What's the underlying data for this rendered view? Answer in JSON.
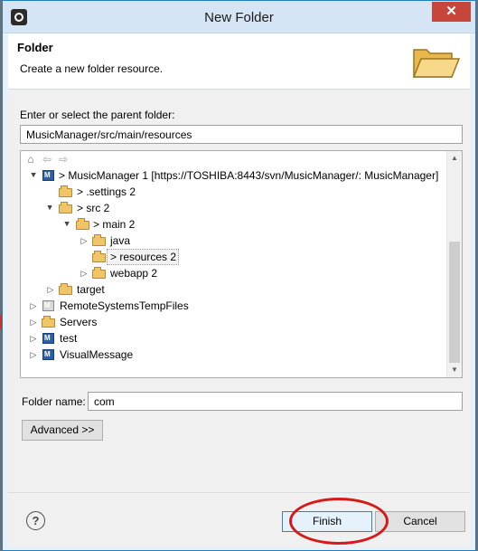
{
  "window": {
    "title": "New Folder",
    "close_glyph": "✕"
  },
  "header": {
    "title": "Folder",
    "description": "Create a new folder resource."
  },
  "parent": {
    "label": "Enter or select the parent folder:",
    "value": "MusicManager/src/main/resources"
  },
  "tree": {
    "toolbar": [
      "home-icon",
      "back-icon",
      "forward-icon"
    ],
    "items": [
      {
        "label": "> MusicManager 1 [https://TOSHIBA:8443/svn/MusicManager/: MusicManager]",
        "icon": "project-icon",
        "twisty": "▲"
      },
      {
        "label": "> .settings 2",
        "icon": "folder-icon",
        "twisty": ""
      },
      {
        "label": "> src 2",
        "icon": "folder-icon",
        "twisty": "▲"
      },
      {
        "label": "> main 2",
        "icon": "folder-icon",
        "twisty": "▲"
      },
      {
        "label": "java",
        "icon": "folder-icon",
        "twisty": "▷"
      },
      {
        "label": "> resources 2",
        "icon": "folder-icon",
        "twisty": ""
      },
      {
        "label": "webapp 2",
        "icon": "folder-icon",
        "twisty": "▷"
      },
      {
        "label": "target",
        "icon": "folder-icon",
        "twisty": "▷"
      },
      {
        "label": "RemoteSystemsTempFiles",
        "icon": "project-icon",
        "twisty": "▷"
      },
      {
        "label": "Servers",
        "icon": "folder-icon",
        "twisty": "▷"
      },
      {
        "label": "test",
        "icon": "project-icon",
        "twisty": "▷"
      },
      {
        "label": "VisualMessage",
        "icon": "project-icon",
        "twisty": "▷"
      }
    ],
    "selected": "> resources 2"
  },
  "folder_name": {
    "label": "Folder name:",
    "value": "com"
  },
  "buttons": {
    "advanced": "Advanced >>",
    "help": "?",
    "finish": "Finish",
    "cancel": "Cancel"
  },
  "colors": {
    "annotation": "#d61a1a",
    "title_bar": "#d6e5f5",
    "close": "#c7463c"
  }
}
